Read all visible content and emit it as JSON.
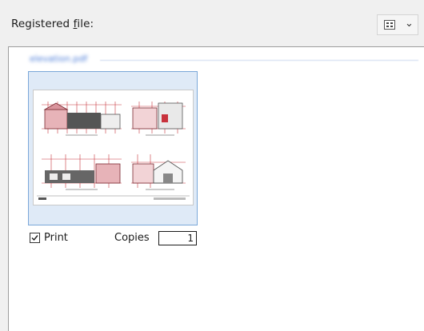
{
  "header": {
    "title_prefix": "Registered ",
    "title_accel": "f",
    "title_suffix": "ile:",
    "view_button_icon": "large-icons-view-icon",
    "view_dropdown_icon": "chevron-down-icon"
  },
  "file": {
    "group_label": "elevation.pdf",
    "thumbnail_icon": "pdf-page-thumbnail",
    "print_label": "Print",
    "print_checked": true,
    "copies_label": "Copies",
    "copies_value": "1"
  },
  "colors": {
    "accent_border": "#7aa7d9",
    "tile_fill": "#dfeaf7",
    "drawing_red": "#c8323c"
  }
}
